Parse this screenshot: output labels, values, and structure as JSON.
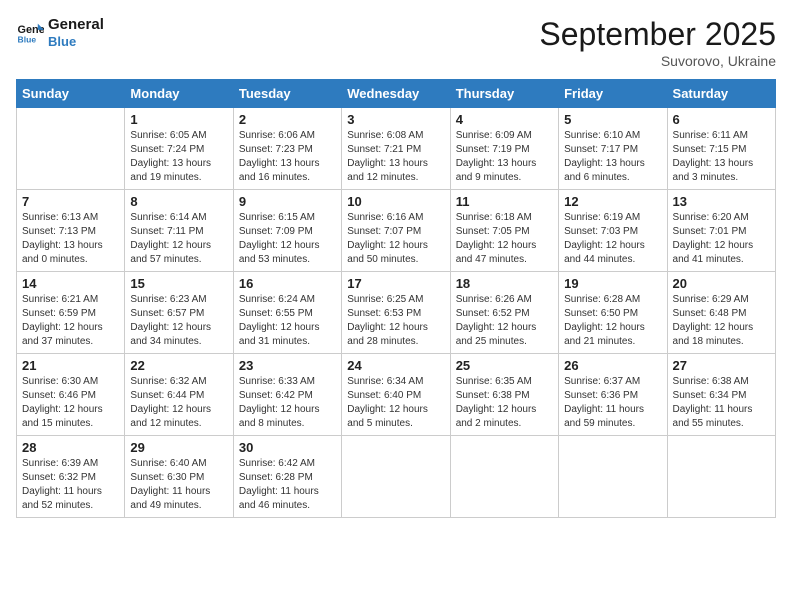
{
  "header": {
    "logo_line1": "General",
    "logo_line2": "Blue",
    "month": "September 2025",
    "location": "Suvorovo, Ukraine"
  },
  "days_of_week": [
    "Sunday",
    "Monday",
    "Tuesday",
    "Wednesday",
    "Thursday",
    "Friday",
    "Saturday"
  ],
  "weeks": [
    [
      {
        "day": "",
        "info": ""
      },
      {
        "day": "1",
        "info": "Sunrise: 6:05 AM\nSunset: 7:24 PM\nDaylight: 13 hours\nand 19 minutes."
      },
      {
        "day": "2",
        "info": "Sunrise: 6:06 AM\nSunset: 7:23 PM\nDaylight: 13 hours\nand 16 minutes."
      },
      {
        "day": "3",
        "info": "Sunrise: 6:08 AM\nSunset: 7:21 PM\nDaylight: 13 hours\nand 12 minutes."
      },
      {
        "day": "4",
        "info": "Sunrise: 6:09 AM\nSunset: 7:19 PM\nDaylight: 13 hours\nand 9 minutes."
      },
      {
        "day": "5",
        "info": "Sunrise: 6:10 AM\nSunset: 7:17 PM\nDaylight: 13 hours\nand 6 minutes."
      },
      {
        "day": "6",
        "info": "Sunrise: 6:11 AM\nSunset: 7:15 PM\nDaylight: 13 hours\nand 3 minutes."
      }
    ],
    [
      {
        "day": "7",
        "info": "Sunrise: 6:13 AM\nSunset: 7:13 PM\nDaylight: 13 hours\nand 0 minutes."
      },
      {
        "day": "8",
        "info": "Sunrise: 6:14 AM\nSunset: 7:11 PM\nDaylight: 12 hours\nand 57 minutes."
      },
      {
        "day": "9",
        "info": "Sunrise: 6:15 AM\nSunset: 7:09 PM\nDaylight: 12 hours\nand 53 minutes."
      },
      {
        "day": "10",
        "info": "Sunrise: 6:16 AM\nSunset: 7:07 PM\nDaylight: 12 hours\nand 50 minutes."
      },
      {
        "day": "11",
        "info": "Sunrise: 6:18 AM\nSunset: 7:05 PM\nDaylight: 12 hours\nand 47 minutes."
      },
      {
        "day": "12",
        "info": "Sunrise: 6:19 AM\nSunset: 7:03 PM\nDaylight: 12 hours\nand 44 minutes."
      },
      {
        "day": "13",
        "info": "Sunrise: 6:20 AM\nSunset: 7:01 PM\nDaylight: 12 hours\nand 41 minutes."
      }
    ],
    [
      {
        "day": "14",
        "info": "Sunrise: 6:21 AM\nSunset: 6:59 PM\nDaylight: 12 hours\nand 37 minutes."
      },
      {
        "day": "15",
        "info": "Sunrise: 6:23 AM\nSunset: 6:57 PM\nDaylight: 12 hours\nand 34 minutes."
      },
      {
        "day": "16",
        "info": "Sunrise: 6:24 AM\nSunset: 6:55 PM\nDaylight: 12 hours\nand 31 minutes."
      },
      {
        "day": "17",
        "info": "Sunrise: 6:25 AM\nSunset: 6:53 PM\nDaylight: 12 hours\nand 28 minutes."
      },
      {
        "day": "18",
        "info": "Sunrise: 6:26 AM\nSunset: 6:52 PM\nDaylight: 12 hours\nand 25 minutes."
      },
      {
        "day": "19",
        "info": "Sunrise: 6:28 AM\nSunset: 6:50 PM\nDaylight: 12 hours\nand 21 minutes."
      },
      {
        "day": "20",
        "info": "Sunrise: 6:29 AM\nSunset: 6:48 PM\nDaylight: 12 hours\nand 18 minutes."
      }
    ],
    [
      {
        "day": "21",
        "info": "Sunrise: 6:30 AM\nSunset: 6:46 PM\nDaylight: 12 hours\nand 15 minutes."
      },
      {
        "day": "22",
        "info": "Sunrise: 6:32 AM\nSunset: 6:44 PM\nDaylight: 12 hours\nand 12 minutes."
      },
      {
        "day": "23",
        "info": "Sunrise: 6:33 AM\nSunset: 6:42 PM\nDaylight: 12 hours\nand 8 minutes."
      },
      {
        "day": "24",
        "info": "Sunrise: 6:34 AM\nSunset: 6:40 PM\nDaylight: 12 hours\nand 5 minutes."
      },
      {
        "day": "25",
        "info": "Sunrise: 6:35 AM\nSunset: 6:38 PM\nDaylight: 12 hours\nand 2 minutes."
      },
      {
        "day": "26",
        "info": "Sunrise: 6:37 AM\nSunset: 6:36 PM\nDaylight: 11 hours\nand 59 minutes."
      },
      {
        "day": "27",
        "info": "Sunrise: 6:38 AM\nSunset: 6:34 PM\nDaylight: 11 hours\nand 55 minutes."
      }
    ],
    [
      {
        "day": "28",
        "info": "Sunrise: 6:39 AM\nSunset: 6:32 PM\nDaylight: 11 hours\nand 52 minutes."
      },
      {
        "day": "29",
        "info": "Sunrise: 6:40 AM\nSunset: 6:30 PM\nDaylight: 11 hours\nand 49 minutes."
      },
      {
        "day": "30",
        "info": "Sunrise: 6:42 AM\nSunset: 6:28 PM\nDaylight: 11 hours\nand 46 minutes."
      },
      {
        "day": "",
        "info": ""
      },
      {
        "day": "",
        "info": ""
      },
      {
        "day": "",
        "info": ""
      },
      {
        "day": "",
        "info": ""
      }
    ]
  ]
}
